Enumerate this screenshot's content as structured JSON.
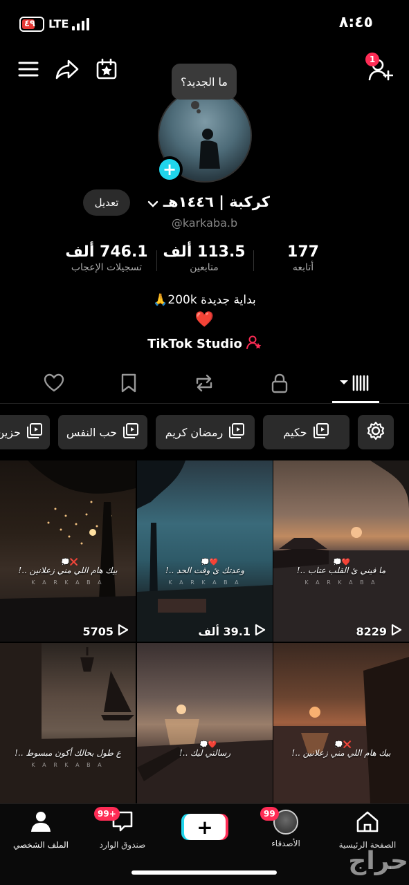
{
  "status_bar": {
    "battery": "٤٩",
    "network": "LTE",
    "time": "٨:٤٥"
  },
  "top_nav": {
    "notification_count": "1"
  },
  "profile": {
    "bubble": "ما الجديد؟",
    "edit_label": "تعديل",
    "display_name": "كركبة | ١٤٤٦هـ",
    "username": "@karkaba.b",
    "stats": [
      {
        "value": "177",
        "label": "أتابعه"
      },
      {
        "value": "113.5 ألف",
        "label": "متابعين"
      },
      {
        "value": "746.1 ألف",
        "label": "تسجيلات الإعجاب"
      }
    ],
    "bio_line1": "بداية جديدة 200k🙏",
    "bio_line2": "❤️",
    "studio_label": "TikTok Studio"
  },
  "chips": [
    "حكيم",
    "رمضان كريم",
    "حب النفس",
    "حزين"
  ],
  "videos": [
    {
      "caption": "ما فيني ئ القلب عتاب ..!",
      "sub": "K A R K A B A",
      "views": "8229"
    },
    {
      "caption": "وعدتك ئ وقت الحد ..!",
      "sub": "K A R K A B A",
      "views": "39.1 ألف"
    },
    {
      "caption": "بيك هام اللي مني زعلانين ..!",
      "sub": "K A R K A B A",
      "views": "5705"
    },
    {
      "caption": "بيك هام اللي مني زعلانين ..!",
      "sub": "",
      "views": ""
    },
    {
      "caption": "رسالتي ليك ..!",
      "sub": "",
      "views": ""
    },
    {
      "caption": "ع طول بحالك أكون مبسوط ..!",
      "sub": "K A R K A B A",
      "views": ""
    }
  ],
  "bottom_nav": {
    "home": "الصفحة الرئيسية",
    "friends": "الأصدقاء",
    "friends_badge": "99",
    "inbox": "صندوق الوارد",
    "inbox_badge": "99+",
    "profile": "الملف الشخصي"
  },
  "watermark": "حراج",
  "colors": {
    "accent_red": "#fe2c55",
    "accent_cyan": "#20d5ec",
    "background": "#000000"
  }
}
